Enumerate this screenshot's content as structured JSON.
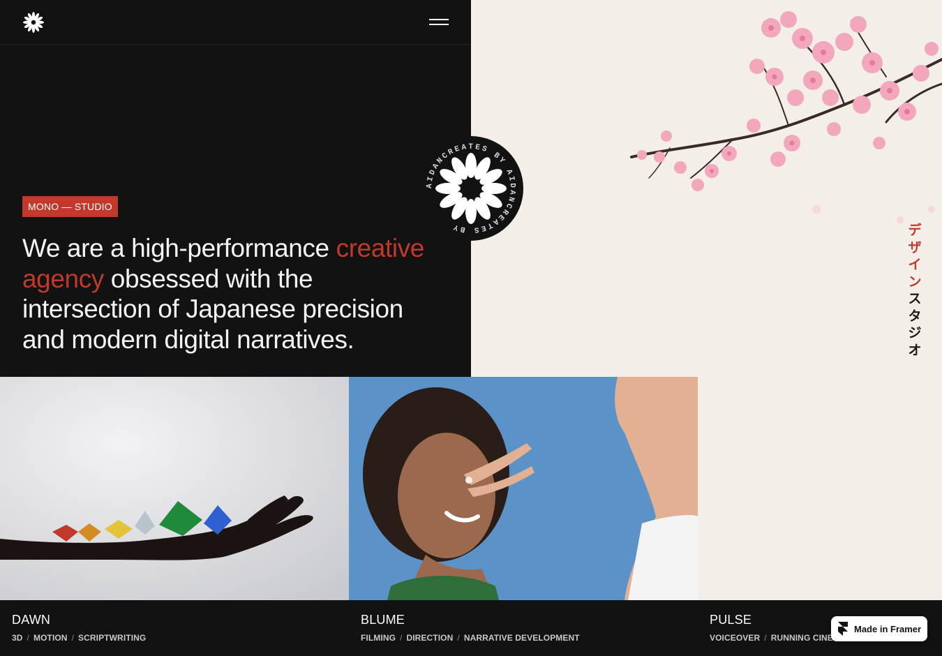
{
  "header": {
    "logo_icon": "flower-icon",
    "menu_icon": "hamburger-menu-icon"
  },
  "hero": {
    "badge": "MONO — STUDIO",
    "headline_part1": "We are a high-performance ",
    "headline_accent": "creative agency",
    "headline_part2": " obsessed with the intersection of Japanese precision and modern digital narratives.",
    "stamp_text": "AIDANCREATES BY AIDANCREATES BY ",
    "vertical_red": "デザイン",
    "vertical_dark": "スタジオ"
  },
  "colors": {
    "accent": "#c0392b",
    "dark_bg": "#121212",
    "cream_bg": "#f3eee8"
  },
  "projects": [
    {
      "title": "DAWN",
      "tags": [
        "3D",
        "MOTION",
        "SCRIPTWRITING"
      ]
    },
    {
      "title": "BLUME",
      "tags": [
        "FILMING",
        "DIRECTION",
        "NARRATIVE DEVELOPMENT"
      ]
    },
    {
      "title": "PULSE",
      "tags": [
        "VOICEOVER",
        "RUNNING CINE"
      ]
    }
  ],
  "framer_badge": {
    "label": "Made in Framer",
    "icon": "framer-logo-icon"
  }
}
